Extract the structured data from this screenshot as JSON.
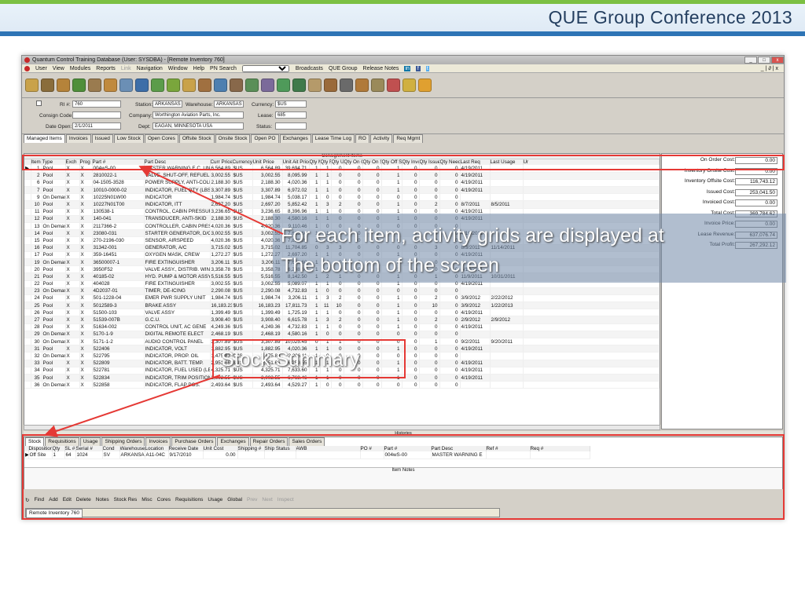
{
  "slide": {
    "title": "QUE Group Conference 2013",
    "callout1_line1": "For each item, activity grids are displayed at",
    "callout1_line2": "The bottom of the screen",
    "callout2": "Stock Summary"
  },
  "window": {
    "title": "Quantum Control Training Database (User: SYSDBA) - [Remote Inventory 760]"
  },
  "menu": {
    "items": [
      "User",
      "View",
      "Modules",
      "Reports",
      "Link",
      "Navigation",
      "Window",
      "Help"
    ],
    "pn_search": "PN Search",
    "broadcasts": "Broadcasts",
    "que_group": "QUE Group",
    "release_notes": "Release Notes",
    "win_controls": "_ | ∂ | x"
  },
  "header": {
    "ri_label": "RI #:",
    "ri_value": "760",
    "station_label": "Station:",
    "station_value": "ARKANSAS",
    "warehouse_label": "Warehouse:",
    "warehouse_value": "ARKANSAS",
    "currency_label": "Currency:",
    "currency_value": "$US",
    "consign_label": "Consign Code:",
    "company_label": "Company:",
    "company_value": "Worthington Aviation Parts, Inc.",
    "lease_label": "Lease:",
    "lease_value": "685",
    "date_label": "Date Open:",
    "date_value": "2/1/2011",
    "dept_label": "Dept:",
    "dept_value": "EAGAN, MINNESOTA USA",
    "status_label": "Status:"
  },
  "tabs": [
    "Managed Items",
    "Invoices",
    "Issued",
    "Low Stock",
    "Open Cores",
    "Offsite Stock",
    "Onsite Stock",
    "Open PO",
    "Exchanges",
    "Lease Time Log",
    "RO",
    "Activity",
    "Req Mgmt"
  ],
  "grid": {
    "group_title": "Consignment Items",
    "columns": [
      "Item #",
      "Type",
      "Exch",
      "Prog",
      "Part #",
      "Part Desc",
      "Curr Price",
      "Currency",
      "Unit Price",
      "Unit Ait Price",
      "Qty Min",
      "Qty Req",
      "Qty Used",
      "Qty On Order",
      "Qty On Site",
      "Qty Off Site",
      "Qty Invc",
      "Qty Issued",
      "Qty Needed",
      "Last Req",
      "Last Usage",
      "Ur"
    ],
    "rows": [
      [
        "1",
        "Pool",
        "X",
        "X",
        "004wS-00",
        "MASTER WARNING E.C. UNI",
        "6,564.89",
        "$US",
        "6,564.89",
        "39,694.71",
        "1",
        "1",
        "0",
        "0",
        "0",
        "1",
        "0",
        "0",
        "0",
        "4/19/2011",
        ""
      ],
      [
        "2",
        "Pool",
        "X",
        "X",
        "2810022-1",
        "VALVE, SHUT-OFF, REFUEL",
        "3,002.55",
        "$US",
        "3,002.55",
        "8,095.99",
        "1",
        "1",
        "0",
        "0",
        "0",
        "1",
        "0",
        "0",
        "0",
        "4/19/2011",
        ""
      ],
      [
        "6",
        "Pool",
        "X",
        "X",
        "04-1505-3528",
        "POWER SUPPLY, ANTI-COLL",
        "2,188.30",
        "$US",
        "2,188.30",
        "4,020.36",
        "1",
        "1",
        "0",
        "0",
        "0",
        "1",
        "0",
        "0",
        "0",
        "4/19/2011",
        ""
      ],
      [
        "7",
        "Pool",
        "X",
        "X",
        "10010-0000-02",
        "INDICATOR, FUEL QTY (LBS",
        "3,307.89",
        "$US",
        "3,307.89",
        "6,972.02",
        "1",
        "1",
        "0",
        "0",
        "0",
        "1",
        "0",
        "0",
        "0",
        "4/19/2011",
        ""
      ],
      [
        "9",
        "On Demand",
        "X",
        "X",
        "10225N01W00",
        "INDICATOR",
        "1,984.74",
        "$US",
        "1,984.74",
        "5,038.17",
        "1",
        "0",
        "0",
        "0",
        "0",
        "0",
        "0",
        "0",
        "0",
        "",
        ""
      ],
      [
        "10",
        "Pool",
        "X",
        "X",
        "10227N01T00",
        "INDICATOR, ITT",
        "2,697.20",
        "$US",
        "2,697.20",
        "5,852.42",
        "1",
        "3",
        "2",
        "0",
        "0",
        "1",
        "0",
        "2",
        "0",
        "8/7/2011",
        "8/5/2011"
      ],
      [
        "11",
        "Pool",
        "X",
        "X",
        "130538-1",
        "CONTROL, CABIN PRESSURI",
        "3,236.65",
        "$US",
        "3,236.65",
        "8,396.96",
        "1",
        "1",
        "0",
        "0",
        "0",
        "1",
        "0",
        "0",
        "0",
        "4/19/2011",
        ""
      ],
      [
        "12",
        "Pool",
        "X",
        "X",
        "140-041",
        "TRANSDUCER, ANTI-SKID",
        "2,188.30",
        "$US",
        "2,188.30",
        "4,580.16",
        "1",
        "1",
        "0",
        "0",
        "0",
        "1",
        "0",
        "0",
        "0",
        "4/19/2011",
        ""
      ],
      [
        "13",
        "On Demand",
        "X",
        "X",
        "2117366-2",
        "CONTROLLER, CABIN PRESS",
        "4,020.36",
        "$US",
        "4,020.36",
        "9,110.46",
        "1",
        "0",
        "0",
        "0",
        "0",
        "0",
        "0",
        "0",
        "0",
        "",
        ""
      ],
      [
        "14",
        "Pool",
        "X",
        "X",
        "23080-031",
        "STARTER GENERATOR, D/C",
        "3,002.55",
        "$US",
        "3,002.55",
        "7,633.60",
        "1",
        "1",
        "0",
        "0",
        "0",
        "1",
        "0",
        "0",
        "0",
        "4/19/2011",
        ""
      ],
      [
        "15",
        "Pool",
        "X",
        "X",
        "270-2196-030",
        "SENSOR, AIRSPEED",
        "4,020.36",
        "$US",
        "4,020.36",
        "7,888.05",
        "1",
        "0",
        "0",
        "0",
        "0",
        "0",
        "0",
        "0",
        "0",
        "",
        ""
      ],
      [
        "16",
        "Pool",
        "X",
        "X",
        "31342-001",
        "GENERATOR, A/C",
        "3,715.02",
        "$US",
        "3,715.02",
        "11,704.85",
        "0",
        "3",
        "3",
        "0",
        "0",
        "0",
        "0",
        "3",
        "0",
        "8/3/2011",
        "11/14/2011"
      ],
      [
        "17",
        "Pool",
        "X",
        "X",
        "359-16451",
        "OXYGEN MASK, CREW",
        "1,272.27",
        "$US",
        "1,272.27",
        "2,697.20",
        "1",
        "1",
        "0",
        "0",
        "0",
        "1",
        "0",
        "0",
        "0",
        "4/19/2011",
        ""
      ],
      [
        "19",
        "On Demand",
        "X",
        "X",
        "36500007-1",
        "FIRE EXTINGUISHER",
        "3,206.11",
        "$US",
        "3,206.11",
        "7,633.60",
        "1",
        "0",
        "0",
        "0",
        "0",
        "0",
        "0",
        "0",
        "0",
        "",
        ""
      ],
      [
        "20",
        "Pool",
        "X",
        "X",
        "3950F52",
        "VALVE ASSY., DISTRIB. WINI",
        "3,358.78",
        "$US",
        "3,358.78",
        "6,208.66",
        "1",
        "1",
        "0",
        "0",
        "0",
        "1",
        "0",
        "0",
        "0",
        "4/19/2011",
        ""
      ],
      [
        "21",
        "Pool",
        "X",
        "X",
        "40185-02",
        "HYD. PUMP & MOTOR ASSY.",
        "5,516.55",
        "$US",
        "5,516.55",
        "8,142.50",
        "1",
        "2",
        "1",
        "0",
        "0",
        "1",
        "0",
        "1",
        "0",
        "11/9/2011",
        "10/31/2011"
      ],
      [
        "22",
        "Pool",
        "X",
        "X",
        "404028",
        "FIRE EXTINGUISHER",
        "3,002.55",
        "$US",
        "3,002.55",
        "5,089.07",
        "1",
        "1",
        "0",
        "0",
        "0",
        "1",
        "0",
        "0",
        "0",
        "4/19/2011",
        ""
      ],
      [
        "23",
        "On Demand",
        "X",
        "X",
        "4D2037-01",
        "TIMER, DE-ICING",
        "2,290.08",
        "$US",
        "2,290.08",
        "4,732.83",
        "1",
        "0",
        "0",
        "0",
        "0",
        "0",
        "0",
        "0",
        "0",
        "",
        ""
      ],
      [
        "24",
        "Pool",
        "X",
        "X",
        "501-1228-04",
        "EMER PWR SUPPLY UNIT",
        "1,984.74",
        "$US",
        "1,984.74",
        "3,206.11",
        "1",
        "3",
        "2",
        "0",
        "0",
        "1",
        "0",
        "2",
        "0",
        "3/9/2012",
        "2/22/2012"
      ],
      [
        "25",
        "Pool",
        "X",
        "X",
        "5012589-3",
        "BRAKE ASSY",
        "16,183.23",
        "$US",
        "16,183.23",
        "17,811.73",
        "1",
        "11",
        "10",
        "0",
        "0",
        "1",
        "0",
        "10",
        "0",
        "3/9/2012",
        "1/22/2013"
      ],
      [
        "26",
        "Pool",
        "X",
        "X",
        "51500-103",
        "VALVE ASSY",
        "1,399.49",
        "$US",
        "1,399.49",
        "1,725.19",
        "1",
        "1",
        "0",
        "0",
        "0",
        "1",
        "0",
        "0",
        "0",
        "4/19/2011",
        ""
      ],
      [
        "27",
        "Pool",
        "X",
        "X",
        "51539-007B",
        "G.C.U.",
        "3,908.40",
        "$US",
        "3,908.40",
        "6,615.78",
        "1",
        "3",
        "2",
        "0",
        "0",
        "1",
        "0",
        "2",
        "0",
        "2/9/2012",
        "2/9/2012"
      ],
      [
        "28",
        "Pool",
        "X",
        "X",
        "51634-002",
        "CONTROL UNIT, AC GENE",
        "4,249.36",
        "$US",
        "4,249.36",
        "4,732.83",
        "1",
        "1",
        "0",
        "0",
        "0",
        "1",
        "0",
        "0",
        "0",
        "4/19/2011",
        ""
      ],
      [
        "29",
        "On Demand",
        "X",
        "X",
        "5170-1-9",
        "DIGITAL REMOTE ELECT",
        "2,468.19",
        "$US",
        "2,468.19",
        "4,580.16",
        "1",
        "0",
        "0",
        "0",
        "0",
        "0",
        "0",
        "0",
        "0",
        "",
        ""
      ],
      [
        "30",
        "On Demand",
        "X",
        "X",
        "5171-1-2",
        "AUDIO CONTROL PANEL",
        "3,307.89",
        "$US",
        "3,307.89",
        "10,025.45",
        "0",
        "1",
        "1",
        "0",
        "0",
        "0",
        "0",
        "1",
        "0",
        "9/2/2011",
        "9/20/2011"
      ],
      [
        "31",
        "Pool",
        "X",
        "X",
        "522406",
        "INDICATOR, VOLT",
        "1,882.95",
        "$US",
        "1,882.95",
        "4,020.36",
        "1",
        "1",
        "0",
        "0",
        "0",
        "1",
        "0",
        "0",
        "0",
        "4/19/2011",
        ""
      ],
      [
        "32",
        "On Demand",
        "X",
        "X",
        "522795",
        "INDICATOR, PROP. OIL",
        "1,475.83",
        "$US",
        "1,475.83",
        "3,206.11",
        "1",
        "0",
        "0",
        "0",
        "0",
        "0",
        "0",
        "0",
        "0",
        "",
        ""
      ],
      [
        "33",
        "Pool",
        "X",
        "X",
        "522809",
        "INDICATOR, BATT. TEMP.",
        "2,951.66",
        "$US",
        "2,951.66",
        "6,259.55",
        "1",
        "1",
        "0",
        "0",
        "0",
        "1",
        "0",
        "0",
        "0",
        "4/19/2011",
        ""
      ],
      [
        "34",
        "Pool",
        "X",
        "X",
        "522781",
        "INDICATOR, FUEL USED (LB)",
        "4,325.71",
        "$US",
        "4,325.71",
        "7,633.60",
        "1",
        "1",
        "0",
        "0",
        "0",
        "1",
        "0",
        "0",
        "0",
        "4/19/2011",
        ""
      ],
      [
        "35",
        "Pool",
        "X",
        "X",
        "522834",
        "INDICATOR, TRIM POSITION",
        "3,002.55",
        "$US",
        "3,002.55",
        "6,768.46",
        "1",
        "1",
        "0",
        "0",
        "0",
        "1",
        "0",
        "0",
        "0",
        "4/19/2011",
        ""
      ],
      [
        "36",
        "On Demand",
        "X",
        "X",
        "522858",
        "INDICATOR, FLAP POS.",
        "2,493.64",
        "$US",
        "2,493.64",
        "4,529.27",
        "1",
        "0",
        "0",
        "0",
        "0",
        "0",
        "0",
        "0",
        "0",
        "",
        ""
      ]
    ]
  },
  "summary": [
    {
      "label": "On Order Cost:",
      "value": "0.00"
    },
    {
      "label": "Inventory Onsite Cost:",
      "value": "0.00"
    },
    {
      "label": "Inventory Offsite Cost:",
      "value": "116,743.12"
    },
    {
      "label": "Issued Cost:",
      "value": "253,041.50"
    },
    {
      "label": "Invoiced Cost:",
      "value": "0.00"
    },
    {
      "label": "Total Cost:",
      "value": "369,784.62"
    },
    {
      "label": "Invoice Price:",
      "value": "0.00"
    },
    {
      "label": "Lease Revenue:",
      "value": "637,076.74"
    },
    {
      "label": "Total Profit:",
      "value": "267,292.12"
    }
  ],
  "history": {
    "bar_title": "Histories",
    "tabs": [
      "Stock",
      "Requisitions",
      "Usage",
      "Shipping Orders",
      "Invoices",
      "Purchase Orders",
      "Exchanges",
      "Repair Orders",
      "Sales Orders"
    ],
    "columns": [
      "Disposition",
      "Qty",
      "SL #",
      "Serial #",
      "Cond",
      "Warehouse",
      "Location",
      "Receive Date",
      "Unit Cost",
      "Shipping #",
      "Ship Status",
      "AWB",
      "PO #",
      "Part #",
      "Part Desc",
      "Ref #",
      "Req #"
    ],
    "row": [
      "Off Site",
      "1",
      "64",
      "1024",
      "SV",
      "ARKANSAS",
      "A11-04C",
      "9/17/2010",
      "0.00",
      "",
      "",
      "",
      "",
      "004wS-00",
      "MASTER WARNING E",
      "",
      ""
    ],
    "item_notes": "Item Notes"
  },
  "bottom_tools": [
    "Find",
    "Add",
    "Edit",
    "Delete",
    "Notes",
    "Stock Res",
    "Misc",
    "Cores",
    "Requisitions",
    "Usage",
    "Global",
    "Prev",
    "Next",
    "Inspect"
  ],
  "window_tab": "Remote Inventory 760"
}
